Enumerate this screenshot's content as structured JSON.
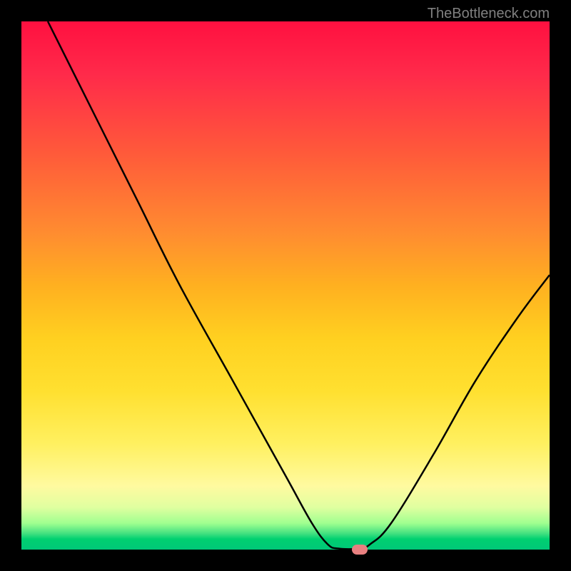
{
  "watermark": "TheBottleneck.com",
  "chart_data": {
    "type": "line",
    "title": "",
    "xlabel": "",
    "ylabel": "",
    "xlim": [
      0,
      100
    ],
    "ylim": [
      0,
      100
    ],
    "curve": [
      {
        "x": 5,
        "y": 100
      },
      {
        "x": 15,
        "y": 80
      },
      {
        "x": 22,
        "y": 66
      },
      {
        "x": 30,
        "y": 50
      },
      {
        "x": 40,
        "y": 32
      },
      {
        "x": 50,
        "y": 14
      },
      {
        "x": 55,
        "y": 5
      },
      {
        "x": 58,
        "y": 1
      },
      {
        "x": 60,
        "y": 0.2
      },
      {
        "x": 64,
        "y": 0.2
      },
      {
        "x": 66,
        "y": 1
      },
      {
        "x": 70,
        "y": 5
      },
      {
        "x": 78,
        "y": 18
      },
      {
        "x": 86,
        "y": 32
      },
      {
        "x": 94,
        "y": 44
      },
      {
        "x": 100,
        "y": 52
      }
    ],
    "marker": {
      "x": 64,
      "y": 0
    },
    "gradient_colors": {
      "top": "#ff1040",
      "bottom": "#00c878"
    }
  }
}
